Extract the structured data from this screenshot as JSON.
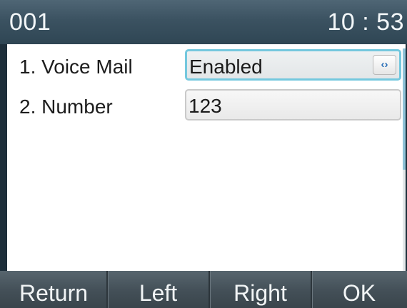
{
  "status_bar": {
    "account": "001",
    "time": "10 : 53"
  },
  "settings": {
    "rows": [
      {
        "label": "1.  Voice Mail",
        "value": "Enabled",
        "control_icon": "left-right-arrows-icon",
        "selected": true
      },
      {
        "label": "2.  Number",
        "value": "123"
      }
    ]
  },
  "softkeys": {
    "return": "Return",
    "left": "Left",
    "right": "Right",
    "ok": "OK"
  },
  "colors": {
    "status_bar": "#3b5261",
    "selected_border": "#74c8de",
    "softkey_bar": "#434f57",
    "scrollbar_thumb": "#8fc3d8"
  }
}
